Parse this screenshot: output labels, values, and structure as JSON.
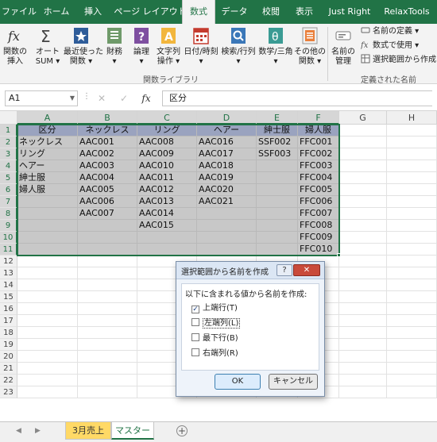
{
  "ribbon_tabs": [
    "ファイル",
    "ホーム",
    "挿入",
    "ページ レイアウト",
    "数式",
    "データ",
    "校閲",
    "表示",
    "Just Right",
    "RelaxTools"
  ],
  "active_tab_index": 4,
  "ribbon": {
    "function_library": {
      "group_label": "関数ライブラリ",
      "buttons": [
        {
          "line1": "関数の",
          "line2": "挿入"
        },
        {
          "line1": "オート",
          "line2": "SUM ▾"
        },
        {
          "line1": "最近使った",
          "line2": "関数 ▾"
        },
        {
          "line1": "財務",
          "line2": "▾"
        },
        {
          "line1": "論理",
          "line2": "▾"
        },
        {
          "line1": "文字列",
          "line2": "操作 ▾"
        },
        {
          "line1": "日付/時刻",
          "line2": "▾"
        },
        {
          "line1": "検索/行列",
          "line2": "▾"
        },
        {
          "line1": "数学/三角",
          "line2": "▾"
        },
        {
          "line1": "その他の",
          "line2": "関数 ▾"
        }
      ]
    },
    "defined_names": {
      "group_label": "定義された名前",
      "name_manager": {
        "line1": "名前の",
        "line2": "管理"
      },
      "commands": [
        "名前の定義 ▾",
        "数式で使用 ▾",
        "選択範囲から作成"
      ]
    }
  },
  "formula_bar": {
    "name_box": "A1",
    "fx_label": "fx",
    "cancel_icon": "✕",
    "enter_icon": "✓",
    "formula": "区分"
  },
  "columns": [
    "A",
    "B",
    "C",
    "D",
    "E",
    "F",
    "G",
    "H"
  ],
  "rows": [
    "1",
    "2",
    "3",
    "4",
    "5",
    "6",
    "7",
    "8",
    "9",
    "10",
    "11",
    "12",
    "13",
    "14",
    "15",
    "16",
    "17",
    "18",
    "19",
    "20",
    "21",
    "22",
    "23"
  ],
  "cells": [
    [
      "区分",
      "ネックレス",
      "リング",
      "ヘアー",
      "紳士服",
      "婦人服"
    ],
    [
      "ネックレス",
      "AAC001",
      "AAC008",
      "AAC016",
      "SSF002",
      "FFC001"
    ],
    [
      "リング",
      "AAC002",
      "AAC009",
      "AAC017",
      "SSF003",
      "FFC002"
    ],
    [
      "ヘアー",
      "AAC003",
      "AAC010",
      "AAC018",
      "",
      "FFC003"
    ],
    [
      "紳士服",
      "AAC004",
      "AAC011",
      "AAC019",
      "",
      "FFC004"
    ],
    [
      "婦人服",
      "AAC005",
      "AAC012",
      "AAC020",
      "",
      "FFC005"
    ],
    [
      "",
      "AAC006",
      "AAC013",
      "AAC021",
      "",
      "FFC006"
    ],
    [
      "",
      "AAC007",
      "AAC014",
      "",
      "",
      "FFC007"
    ],
    [
      "",
      "",
      "AAC015",
      "",
      "",
      "FFC008"
    ],
    [
      "",
      "",
      "",
      "",
      "",
      "FFC009"
    ],
    [
      "",
      "",
      "",
      "",
      "",
      "FFC010"
    ]
  ],
  "sheet_tabs": [
    "3月売上",
    "マスター"
  ],
  "add_sheet_symbol": "+",
  "dialog": {
    "title": "選択範囲から名前を作成",
    "help": "?",
    "close": "✕",
    "instruction": "以下に含まれる値から名前を作成:",
    "options": [
      {
        "label": "上端行(T)",
        "checked": true
      },
      {
        "label": "左端列(L)",
        "checked": false
      },
      {
        "label": "最下行(B)",
        "checked": false
      },
      {
        "label": "右端列(R)",
        "checked": false
      }
    ],
    "ok": "OK",
    "cancel": "キャンセル"
  },
  "colors": {
    "excel_green": "#217346",
    "header_band": "#aab2cc",
    "selection_fill": "#c8c8c8",
    "sheet_tab_yellow": "#ffd966"
  }
}
